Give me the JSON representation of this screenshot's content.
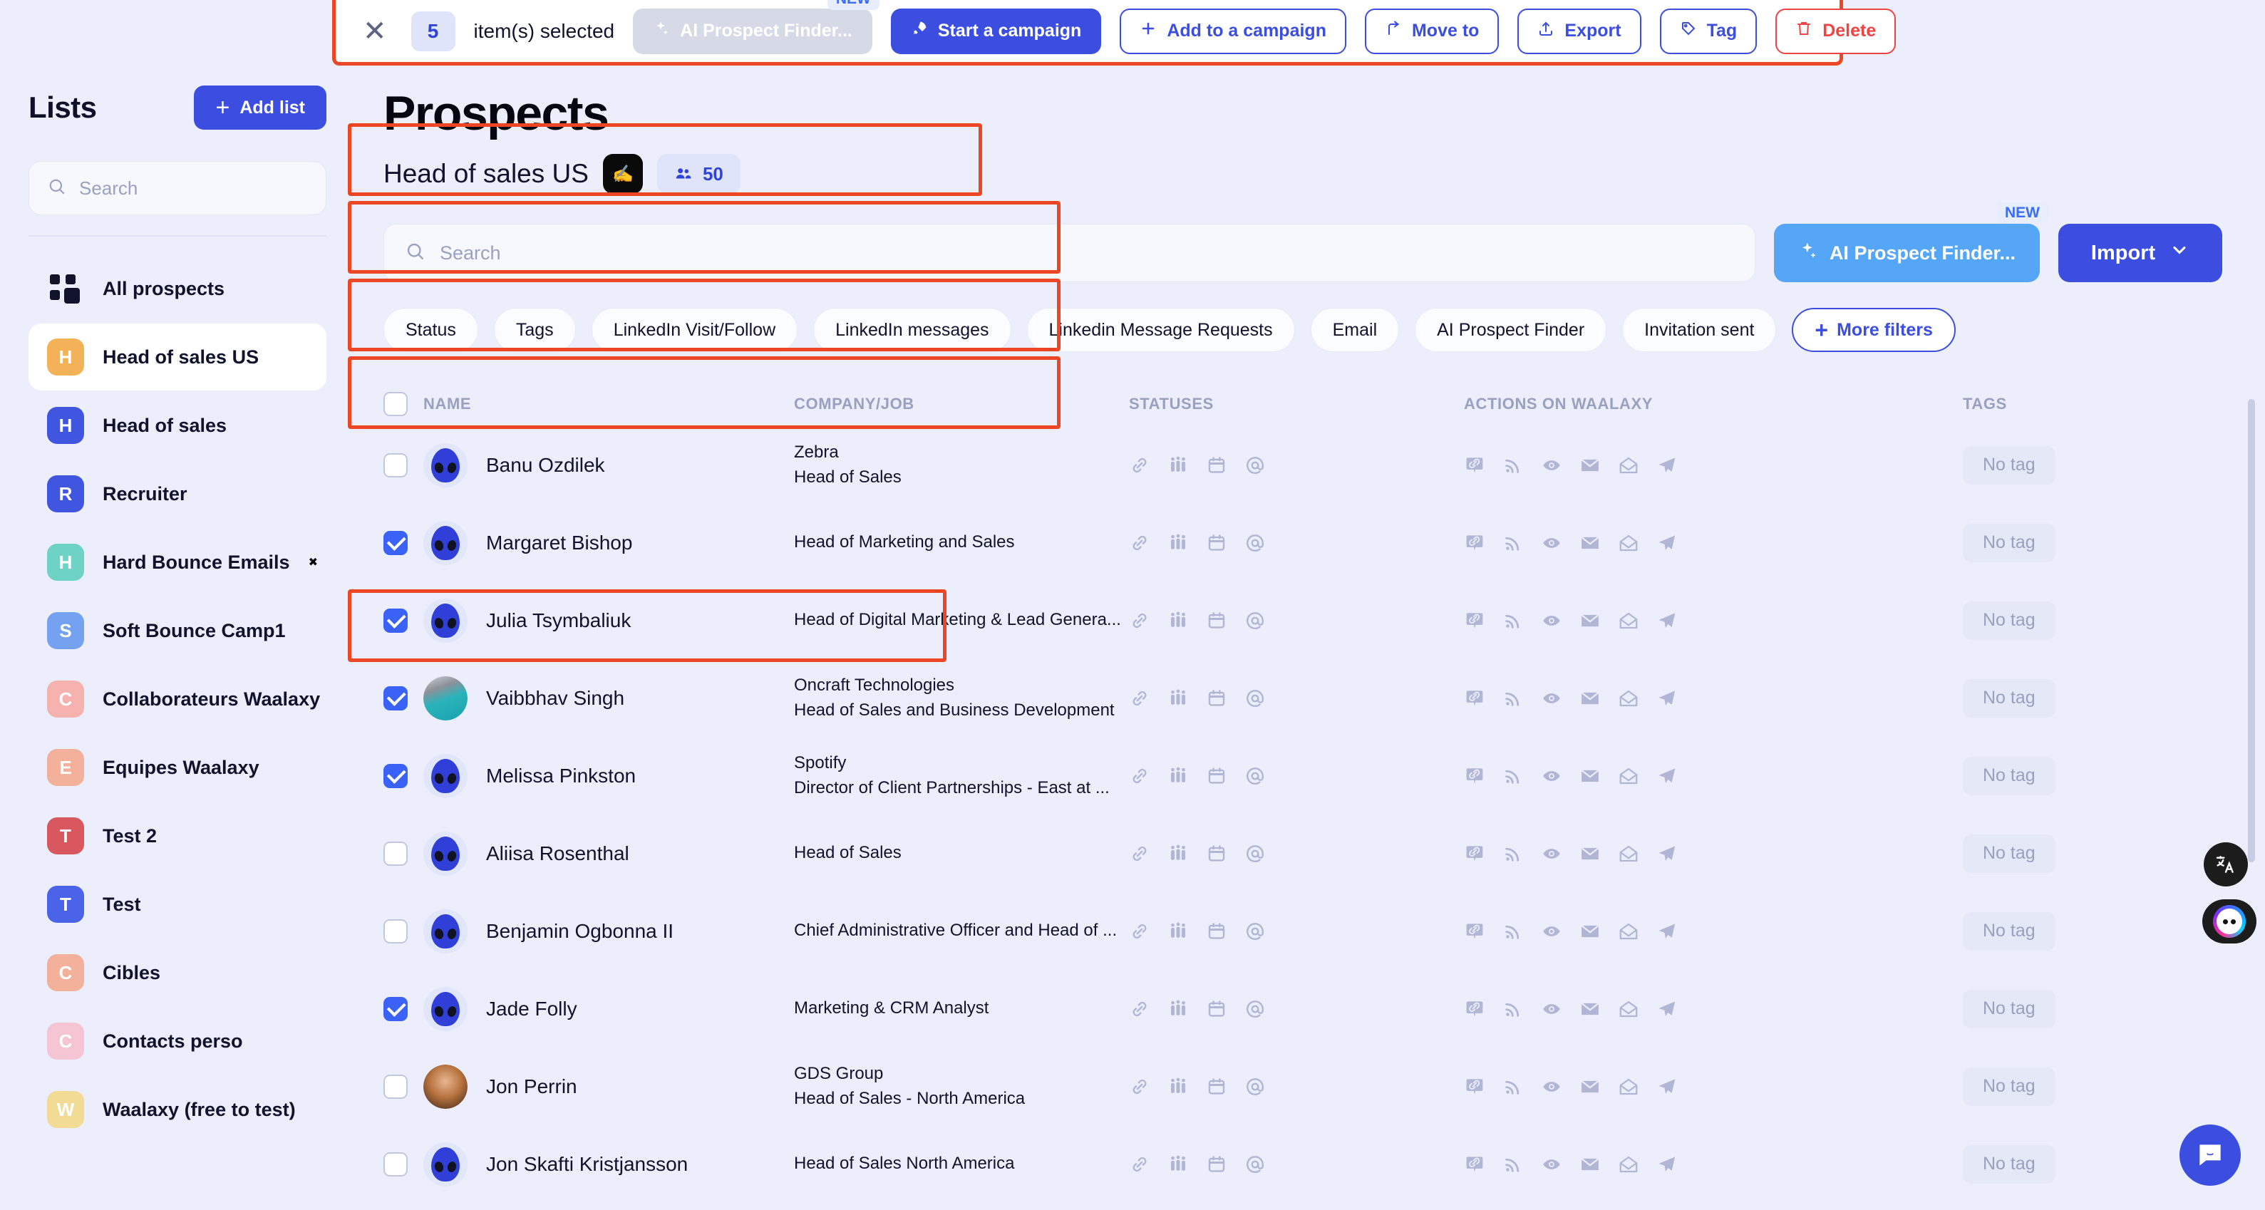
{
  "selection_bar": {
    "close_icon": "close-icon",
    "count": "5",
    "label": "item(s) selected",
    "ai_finder_label": "AI Prospect Finder...",
    "new_badge": "NEW",
    "buttons": [
      {
        "label": "Start a campaign",
        "icon": "rocket-icon",
        "style": "primary"
      },
      {
        "label": "Add to a campaign",
        "icon": "plus-icon",
        "style": "outline"
      },
      {
        "label": "Move to",
        "icon": "arrow-move-icon",
        "style": "outline"
      },
      {
        "label": "Export",
        "icon": "upload-icon",
        "style": "outline"
      },
      {
        "label": "Tag",
        "icon": "tag-icon",
        "style": "outline"
      },
      {
        "label": "Delete",
        "icon": "trash-icon",
        "style": "danger"
      }
    ]
  },
  "sidebar": {
    "title": "Lists",
    "add_list_label": "Add list",
    "search_placeholder": "Search",
    "search_value": "",
    "all_prospects_label": "All prospects",
    "items": [
      {
        "label": "Head of sales US",
        "initial": "H",
        "color": "#f3b257",
        "active": true
      },
      {
        "label": "Head of sales",
        "initial": "H",
        "color": "#4055e0",
        "active": false
      },
      {
        "label": "Recruiter",
        "initial": "R",
        "color": "#4055e0",
        "active": false
      },
      {
        "label": "Hard Bounce Emails",
        "suffix": "✖",
        "initial": "H",
        "color": "#6ed3c4",
        "active": false
      },
      {
        "label": "Soft Bounce Camp1",
        "initial": "S",
        "color": "#74a2f0",
        "active": false
      },
      {
        "label": "Collaborateurs Waalaxy",
        "initial": "C",
        "color": "#f5b2ae",
        "active": false
      },
      {
        "label": "Equipes Waalaxy",
        "initial": "E",
        "color": "#f3b09a",
        "active": false
      },
      {
        "label": "Test 2",
        "initial": "T",
        "color": "#d9575e",
        "active": false
      },
      {
        "label": "Test",
        "initial": "T",
        "color": "#4a63e8",
        "active": false
      },
      {
        "label": "Cibles",
        "initial": "C",
        "color": "#f3b09a",
        "active": false
      },
      {
        "label": "Contacts perso",
        "initial": "C",
        "color": "#f5c5d4",
        "active": false
      },
      {
        "label": "Waalaxy (free to test)",
        "initial": "W",
        "color": "#f2dc95",
        "active": false
      }
    ]
  },
  "header": {
    "page_title": "Prospects",
    "list_name": "Head of sales US",
    "emoji": "✍",
    "member_count": "50",
    "members_icon": "people-icon"
  },
  "search": {
    "placeholder": "Search",
    "value": "",
    "search_icon": "search-icon",
    "ai_finder_label": "AI Prospect Finder...",
    "ai_new_badge": "NEW",
    "import_label": "Import",
    "import_chevron": "chevron-down-icon"
  },
  "filters": {
    "chips": [
      "Status",
      "Tags",
      "LinkedIn Visit/Follow",
      "LinkedIn messages",
      "Linkedin Message Requests",
      "Email",
      "AI Prospect Finder",
      "Invitation sent"
    ],
    "more_label": "More filters"
  },
  "table": {
    "headers": [
      "NAME",
      "COMPANY/JOB",
      "STATUSES",
      "ACTIONS ON WAALAXY",
      "TAGS"
    ],
    "status_icons": [
      "link-icon",
      "people-icon",
      "calendar-icon",
      "at-icon"
    ],
    "action_icons": [
      "message-link-icon",
      "rss-icon",
      "eye-icon",
      "envelope-icon",
      "open-envelope-icon",
      "send-icon"
    ],
    "no_tag_label": "No tag",
    "rows": [
      {
        "name": "Banu Ozdilek",
        "company": "Zebra",
        "job": "Head of Sales",
        "checked": false,
        "highlighted": false,
        "avatar": "alien",
        "tag": "No tag"
      },
      {
        "name": "Margaret Bishop",
        "company": "",
        "job": "Head of Marketing and Sales",
        "checked": true,
        "highlighted": true,
        "avatar": "alien",
        "tag": "No tag"
      },
      {
        "name": "Julia Tsymbaliuk",
        "company": "",
        "job": "Head of Digital Marketing & Lead Genera...",
        "checked": true,
        "highlighted": true,
        "avatar": "alien",
        "tag": "No tag"
      },
      {
        "name": "Vaibbhav Singh",
        "company": "Oncraft Technologies",
        "job": "Head of Sales and Business Development",
        "checked": true,
        "highlighted": true,
        "avatar": "photo-man-teal",
        "tag": "No tag"
      },
      {
        "name": "Melissa Pinkston",
        "company": "Spotify",
        "job": "Director of Client Partnerships - East at ...",
        "checked": true,
        "highlighted": true,
        "avatar": "alien",
        "tag": "No tag"
      },
      {
        "name": "Aliisa Rosenthal",
        "company": "",
        "job": "Head of Sales",
        "checked": false,
        "highlighted": false,
        "avatar": "alien",
        "tag": "No tag"
      },
      {
        "name": "Benjamin Ogbonna II",
        "company": "",
        "job": "Chief Administrative Officer and Head of ...",
        "checked": false,
        "highlighted": false,
        "avatar": "alien",
        "tag": "No tag"
      },
      {
        "name": "Jade Folly",
        "company": "",
        "job": "Marketing & CRM Analyst",
        "checked": true,
        "highlighted": true,
        "avatar": "alien",
        "tag": "No tag"
      },
      {
        "name": "Jon Perrin",
        "company": "GDS Group",
        "job": "Head of Sales - North America",
        "checked": false,
        "highlighted": false,
        "avatar": "photo-man-smile",
        "tag": "No tag"
      },
      {
        "name": "Jon Skafti Kristjansson",
        "company": "",
        "job": "Head of Sales North America",
        "checked": false,
        "highlighted": false,
        "avatar": "alien",
        "tag": "No tag"
      }
    ]
  },
  "floating": {
    "translate_icon": "translate-icon",
    "ninja_icon": "ninja-avatar-icon",
    "chat_icon": "chat-bubble-icon"
  }
}
